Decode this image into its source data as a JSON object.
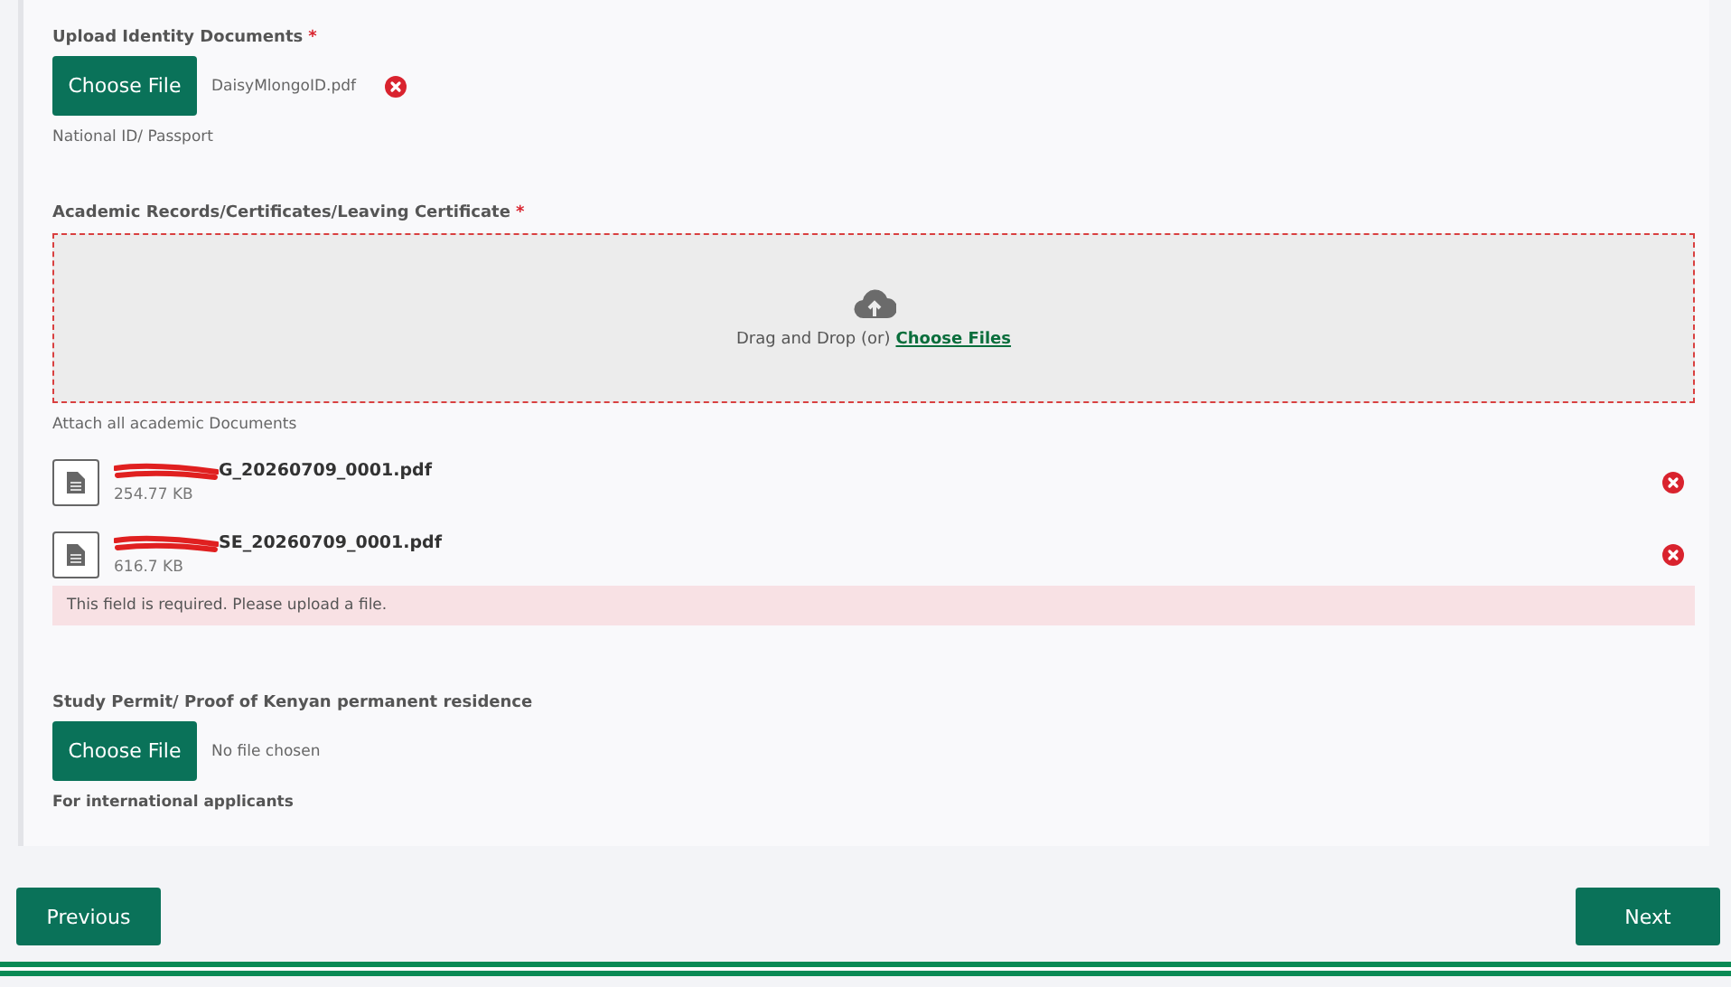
{
  "identity": {
    "label": "Upload Identity Documents",
    "required_mark": "*",
    "button": "Choose File",
    "file": "DaisyMlongoID.pdf",
    "removable": true,
    "hint": "National ID/ Passport"
  },
  "academic": {
    "label": "Academic Records/Certificates/Leaving Certificate",
    "required_mark": "*",
    "drop_text": "Drag and Drop (or)",
    "drop_link": "Choose Files",
    "hint": "Attach all academic Documents",
    "files": [
      {
        "name": "G_20260709_0001.pdf",
        "size": "254.77 KB",
        "redacted": true
      },
      {
        "name": "SE_20260709_0001.pdf",
        "size": "616.7 KB",
        "redacted": true
      }
    ],
    "error": "This field is required. Please upload a file."
  },
  "permit": {
    "label": "Study Permit/ Proof of Kenyan permanent residence",
    "button": "Choose File",
    "file": "No file chosen",
    "hint": "For international applicants"
  },
  "buttons": {
    "previous": "Previous",
    "next": "Next"
  }
}
